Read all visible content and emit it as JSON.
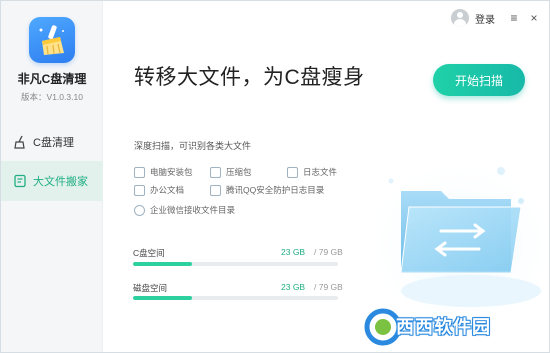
{
  "app": {
    "name": "非凡C盘清理",
    "version": "版本：V1.0.3.10"
  },
  "topbar": {
    "login": "登录",
    "menu_icon": "≡",
    "close_icon": "×"
  },
  "sidebar": {
    "items": [
      {
        "label": "C盘清理",
        "icon": "broom-icon",
        "active": false
      },
      {
        "label": "大文件搬家",
        "icon": "document-icon",
        "active": true
      }
    ]
  },
  "main": {
    "title": "转移大文件，为C盘瘦身",
    "start_button": "开始扫描",
    "description": "深度扫描，可识别各类大文件",
    "categories": [
      {
        "label": "电脑安装包",
        "icon": "package-icon"
      },
      {
        "label": "压缩包",
        "icon": "archive-icon"
      },
      {
        "label": "日志文件",
        "icon": "log-file-icon"
      },
      {
        "label": "办公文档",
        "icon": "folder-icon"
      },
      {
        "label": "腾讯QQ安全防护日志目录",
        "icon": "shield-icon"
      },
      {
        "label": "企业微信接收文件目录",
        "icon": "wechat-icon"
      }
    ],
    "disks": [
      {
        "label": "C盘空间",
        "used": "23 GB",
        "total": "/ 79 GB",
        "fraction": 0.29
      },
      {
        "label": "磁盘空间",
        "used": "23 GB",
        "total": "/ 79 GB",
        "fraction": 0.29
      }
    ]
  },
  "watermark": {
    "text": "西西软件园"
  },
  "colors": {
    "accent": "#1fae82",
    "button": "#1fd1a8",
    "logo": "#2d7df0"
  }
}
